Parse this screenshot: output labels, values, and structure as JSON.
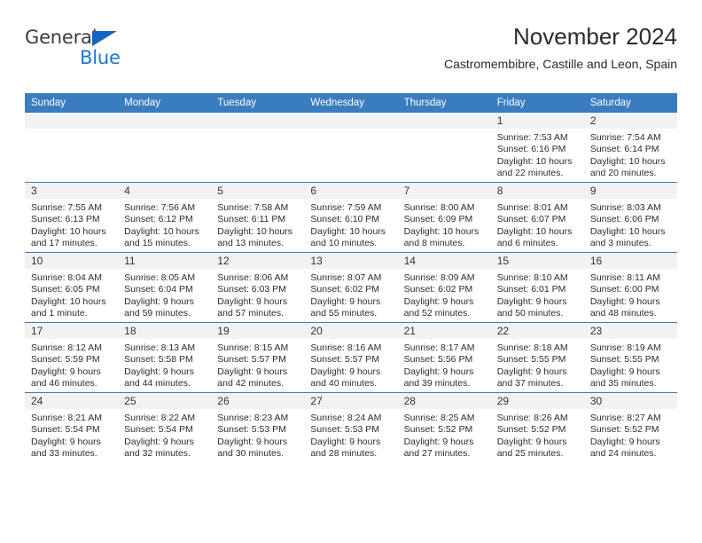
{
  "brand": {
    "name_top": "General",
    "name_bottom": "Blue",
    "accent_color": "#1976d2"
  },
  "header": {
    "title": "November 2024",
    "subtitle": "Castromembibre, Castille and Leon, Spain"
  },
  "theme": {
    "header_row_bg": "#3a7cc0",
    "daynum_bg": "#f2f2f2",
    "text_color": "#2d2d2d"
  },
  "weekday_headers": [
    "Sunday",
    "Monday",
    "Tuesday",
    "Wednesday",
    "Thursday",
    "Friday",
    "Saturday"
  ],
  "weeks": [
    [
      {
        "empty": true
      },
      {
        "empty": true
      },
      {
        "empty": true
      },
      {
        "empty": true
      },
      {
        "empty": true
      },
      {
        "day": "1",
        "sunrise": "Sunrise: 7:53 AM",
        "sunset": "Sunset: 6:16 PM",
        "daylight": "Daylight: 10 hours and 22 minutes."
      },
      {
        "day": "2",
        "sunrise": "Sunrise: 7:54 AM",
        "sunset": "Sunset: 6:14 PM",
        "daylight": "Daylight: 10 hours and 20 minutes."
      }
    ],
    [
      {
        "day": "3",
        "sunrise": "Sunrise: 7:55 AM",
        "sunset": "Sunset: 6:13 PM",
        "daylight": "Daylight: 10 hours and 17 minutes."
      },
      {
        "day": "4",
        "sunrise": "Sunrise: 7:56 AM",
        "sunset": "Sunset: 6:12 PM",
        "daylight": "Daylight: 10 hours and 15 minutes."
      },
      {
        "day": "5",
        "sunrise": "Sunrise: 7:58 AM",
        "sunset": "Sunset: 6:11 PM",
        "daylight": "Daylight: 10 hours and 13 minutes."
      },
      {
        "day": "6",
        "sunrise": "Sunrise: 7:59 AM",
        "sunset": "Sunset: 6:10 PM",
        "daylight": "Daylight: 10 hours and 10 minutes."
      },
      {
        "day": "7",
        "sunrise": "Sunrise: 8:00 AM",
        "sunset": "Sunset: 6:09 PM",
        "daylight": "Daylight: 10 hours and 8 minutes."
      },
      {
        "day": "8",
        "sunrise": "Sunrise: 8:01 AM",
        "sunset": "Sunset: 6:07 PM",
        "daylight": "Daylight: 10 hours and 6 minutes."
      },
      {
        "day": "9",
        "sunrise": "Sunrise: 8:03 AM",
        "sunset": "Sunset: 6:06 PM",
        "daylight": "Daylight: 10 hours and 3 minutes."
      }
    ],
    [
      {
        "day": "10",
        "sunrise": "Sunrise: 8:04 AM",
        "sunset": "Sunset: 6:05 PM",
        "daylight": "Daylight: 10 hours and 1 minute."
      },
      {
        "day": "11",
        "sunrise": "Sunrise: 8:05 AM",
        "sunset": "Sunset: 6:04 PM",
        "daylight": "Daylight: 9 hours and 59 minutes."
      },
      {
        "day": "12",
        "sunrise": "Sunrise: 8:06 AM",
        "sunset": "Sunset: 6:03 PM",
        "daylight": "Daylight: 9 hours and 57 minutes."
      },
      {
        "day": "13",
        "sunrise": "Sunrise: 8:07 AM",
        "sunset": "Sunset: 6:02 PM",
        "daylight": "Daylight: 9 hours and 55 minutes."
      },
      {
        "day": "14",
        "sunrise": "Sunrise: 8:09 AM",
        "sunset": "Sunset: 6:02 PM",
        "daylight": "Daylight: 9 hours and 52 minutes."
      },
      {
        "day": "15",
        "sunrise": "Sunrise: 8:10 AM",
        "sunset": "Sunset: 6:01 PM",
        "daylight": "Daylight: 9 hours and 50 minutes."
      },
      {
        "day": "16",
        "sunrise": "Sunrise: 8:11 AM",
        "sunset": "Sunset: 6:00 PM",
        "daylight": "Daylight: 9 hours and 48 minutes."
      }
    ],
    [
      {
        "day": "17",
        "sunrise": "Sunrise: 8:12 AM",
        "sunset": "Sunset: 5:59 PM",
        "daylight": "Daylight: 9 hours and 46 minutes."
      },
      {
        "day": "18",
        "sunrise": "Sunrise: 8:13 AM",
        "sunset": "Sunset: 5:58 PM",
        "daylight": "Daylight: 9 hours and 44 minutes."
      },
      {
        "day": "19",
        "sunrise": "Sunrise: 8:15 AM",
        "sunset": "Sunset: 5:57 PM",
        "daylight": "Daylight: 9 hours and 42 minutes."
      },
      {
        "day": "20",
        "sunrise": "Sunrise: 8:16 AM",
        "sunset": "Sunset: 5:57 PM",
        "daylight": "Daylight: 9 hours and 40 minutes."
      },
      {
        "day": "21",
        "sunrise": "Sunrise: 8:17 AM",
        "sunset": "Sunset: 5:56 PM",
        "daylight": "Daylight: 9 hours and 39 minutes."
      },
      {
        "day": "22",
        "sunrise": "Sunrise: 8:18 AM",
        "sunset": "Sunset: 5:55 PM",
        "daylight": "Daylight: 9 hours and 37 minutes."
      },
      {
        "day": "23",
        "sunrise": "Sunrise: 8:19 AM",
        "sunset": "Sunset: 5:55 PM",
        "daylight": "Daylight: 9 hours and 35 minutes."
      }
    ],
    [
      {
        "day": "24",
        "sunrise": "Sunrise: 8:21 AM",
        "sunset": "Sunset: 5:54 PM",
        "daylight": "Daylight: 9 hours and 33 minutes."
      },
      {
        "day": "25",
        "sunrise": "Sunrise: 8:22 AM",
        "sunset": "Sunset: 5:54 PM",
        "daylight": "Daylight: 9 hours and 32 minutes."
      },
      {
        "day": "26",
        "sunrise": "Sunrise: 8:23 AM",
        "sunset": "Sunset: 5:53 PM",
        "daylight": "Daylight: 9 hours and 30 minutes."
      },
      {
        "day": "27",
        "sunrise": "Sunrise: 8:24 AM",
        "sunset": "Sunset: 5:53 PM",
        "daylight": "Daylight: 9 hours and 28 minutes."
      },
      {
        "day": "28",
        "sunrise": "Sunrise: 8:25 AM",
        "sunset": "Sunset: 5:52 PM",
        "daylight": "Daylight: 9 hours and 27 minutes."
      },
      {
        "day": "29",
        "sunrise": "Sunrise: 8:26 AM",
        "sunset": "Sunset: 5:52 PM",
        "daylight": "Daylight: 9 hours and 25 minutes."
      },
      {
        "day": "30",
        "sunrise": "Sunrise: 8:27 AM",
        "sunset": "Sunset: 5:52 PM",
        "daylight": "Daylight: 9 hours and 24 minutes."
      }
    ]
  ]
}
